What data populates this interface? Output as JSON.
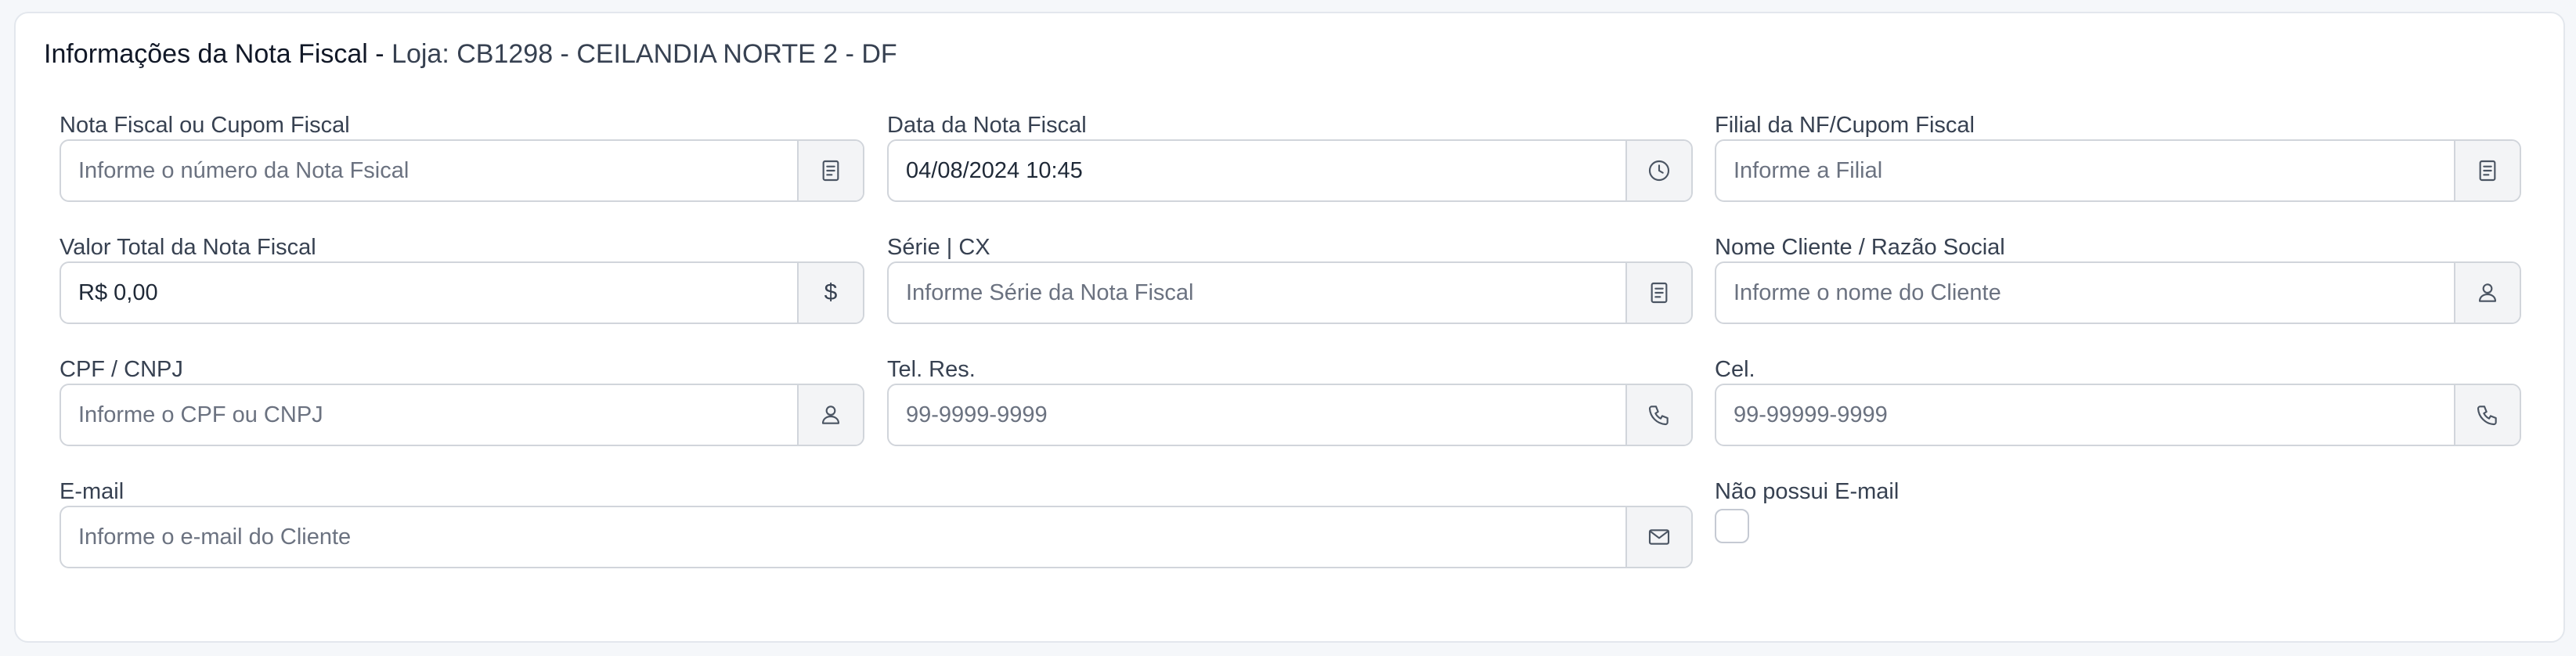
{
  "header": {
    "title": "Informações da Nota Fiscal",
    "separator": " - ",
    "store": "Loja: CB1298 - CEILANDIA NORTE 2 - DF"
  },
  "fields": {
    "nota_fiscal": {
      "label": "Nota Fiscal ou Cupom Fiscal",
      "value": "",
      "placeholder": "Informe o número da Nota Fsical",
      "icon": "receipt-icon"
    },
    "data_nota": {
      "label": "Data da Nota Fiscal",
      "value": "04/08/2024 10:45",
      "placeholder": "",
      "icon": "clock-icon"
    },
    "filial": {
      "label": "Filial da NF/Cupom Fiscal",
      "value": "",
      "placeholder": "Informe a Filial",
      "icon": "receipt-icon"
    },
    "valor_total": {
      "label": "Valor Total da Nota Fiscal",
      "value": "R$ 0,00",
      "placeholder": "",
      "icon_text": "$"
    },
    "serie": {
      "label": "Série | CX",
      "value": "",
      "placeholder": "Informe Série da Nota Fiscal",
      "icon": "receipt-icon"
    },
    "nome_cliente": {
      "label": "Nome Cliente / Razão Social",
      "value": "",
      "placeholder": "Informe o nome do Cliente",
      "icon": "user-icon"
    },
    "cpf_cnpj": {
      "label": "CPF / CNPJ",
      "value": "",
      "placeholder": "Informe o CPF ou CNPJ",
      "icon": "user-icon"
    },
    "tel_res": {
      "label": "Tel. Res.",
      "value": "",
      "placeholder": "99-9999-9999",
      "icon": "phone-icon"
    },
    "cel": {
      "label": "Cel.",
      "value": "",
      "placeholder": "99-99999-9999",
      "icon": "phone-icon"
    },
    "email": {
      "label": "E-mail",
      "value": "",
      "placeholder": "Informe o e-mail do Cliente",
      "icon": "mail-icon"
    },
    "sem_email": {
      "label": "Não possui E-mail",
      "checked": false
    }
  },
  "colors": {
    "page_background": "#f5f7fa",
    "card_border": "#e3e7ed",
    "input_border": "#d1d5db",
    "addon_background": "#f3f4f6",
    "text": "#374151",
    "placeholder": "#6b7280"
  }
}
